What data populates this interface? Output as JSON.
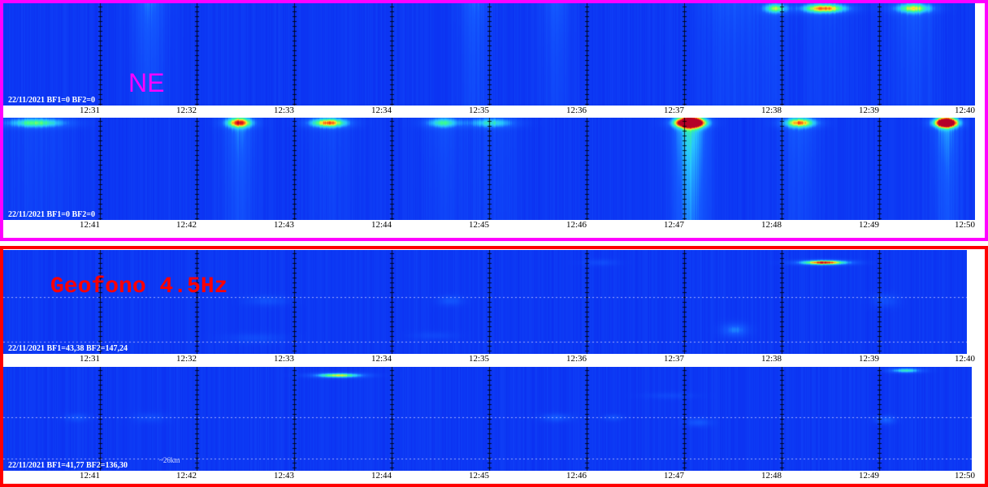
{
  "colors": {
    "top_frame": "#ff00ff",
    "bottom_frame": "#ff0000",
    "spectrogram_base": "#0a2cf0"
  },
  "labels": {
    "ne": "NE",
    "geofono": "Geofono 4.5Hz",
    "distance": "~26km"
  },
  "strips": [
    {
      "id": "ne-1",
      "date_label": "22/11/2021 BF1=0 BF2=0",
      "ticks": [
        "12:31",
        "12:32",
        "12:33",
        "12:34",
        "12:35",
        "12:36",
        "12:37",
        "12:38",
        "12:39",
        "12:40"
      ]
    },
    {
      "id": "ne-2",
      "date_label": "22/11/2021 BF1=0 BF2=0",
      "ticks": [
        "12:41",
        "12:42",
        "12:43",
        "12:44",
        "12:45",
        "12:46",
        "12:47",
        "12:48",
        "12:49",
        "12:50"
      ]
    },
    {
      "id": "geo-1",
      "date_label": "22/11/2021 BF1=43,38 BF2=147,24",
      "ticks": [
        "12:31",
        "12:32",
        "12:33",
        "12:34",
        "12:35",
        "12:36",
        "12:37",
        "12:38",
        "12:39",
        "12:40"
      ]
    },
    {
      "id": "geo-2",
      "date_label": "22/11/2021 BF1=41,77 BF2=136,30",
      "ticks": [
        "12:41",
        "12:42",
        "12:43",
        "12:44",
        "12:45",
        "12:46",
        "12:47",
        "12:48",
        "12:49",
        "12:50"
      ]
    }
  ]
}
